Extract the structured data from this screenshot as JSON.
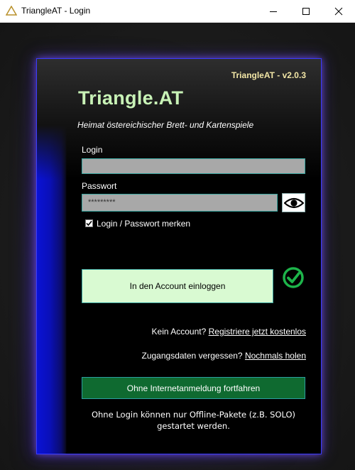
{
  "window": {
    "title": "TriangleAT - Login",
    "minimize_icon": "minimize-icon",
    "maximize_icon": "maximize-icon",
    "close_icon": "close-icon"
  },
  "header": {
    "version": "TriangleAT - v2.0.3",
    "brand": "Triangle.AT",
    "tagline": "Heimat östereichischer Brett- und Kartenspiele"
  },
  "form": {
    "login_label": "Login",
    "login_value": "",
    "password_label": "Passwort",
    "password_value": "*********",
    "show_password_icon": "eye-icon",
    "remember_checked": true,
    "remember_label": "Login / Passwort merken",
    "login_button": "In den Account einloggen",
    "status_icon": "check-circle-icon"
  },
  "links": {
    "no_account_text": "Kein Account?",
    "register_link": "Registriere jetzt kostenlos",
    "forgot_text": "Zugangsdaten vergessen?",
    "forgot_link": "Nochmals holen"
  },
  "offline": {
    "button": "Ohne Internetanmeldung fortfahren",
    "note_line1": "Ohne Login können nur Offline-Pakete (z.B. SOLO)",
    "note_line2": "gestartet werden."
  },
  "colors": {
    "accent_blue": "#0a12d6",
    "brand_green": "#c8f2b6",
    "login_button_bg": "#d9fad2",
    "offline_button_bg": "#0f6a30",
    "check_green": "#1db44a"
  }
}
